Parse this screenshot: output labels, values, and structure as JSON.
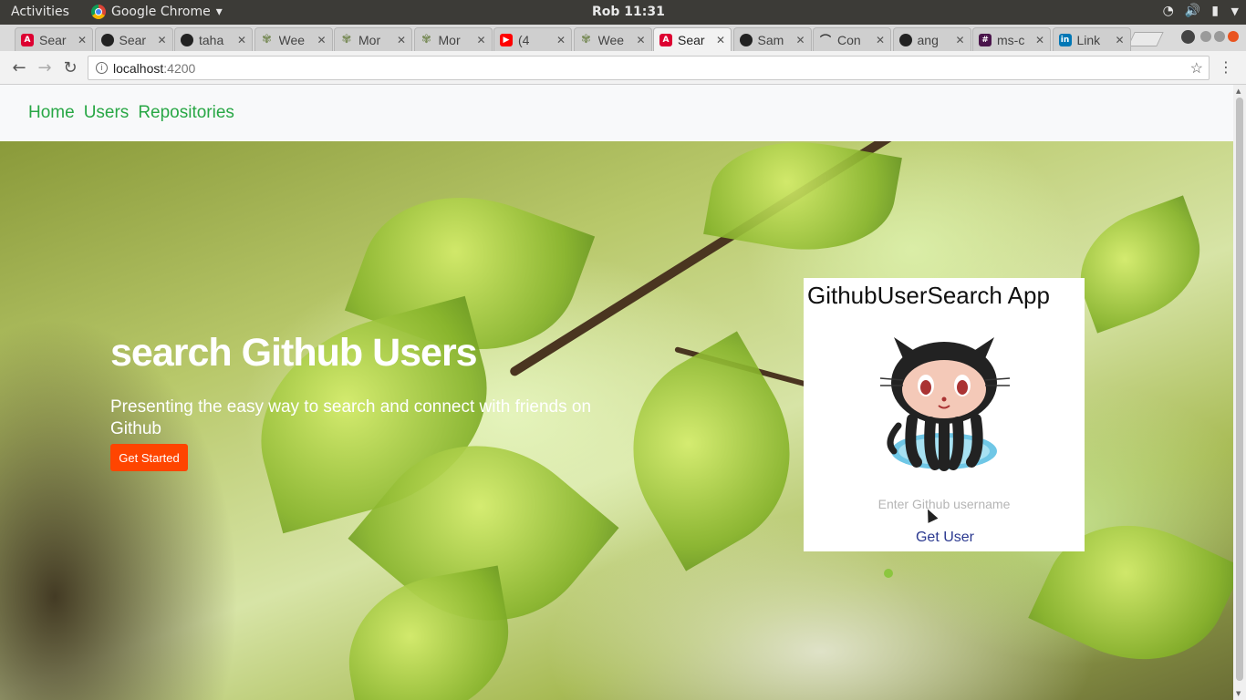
{
  "os_bar": {
    "activities": "Activities",
    "app_name": "Google Chrome",
    "clock": "Rob 11:31"
  },
  "tabs": [
    {
      "favicon": "angular-icon",
      "title": "Sear",
      "active": false
    },
    {
      "favicon": "github-icon",
      "title": "Sear",
      "active": false
    },
    {
      "favicon": "github-icon",
      "title": "taha",
      "active": false
    },
    {
      "favicon": "tree-icon",
      "title": "Wee",
      "active": false
    },
    {
      "favicon": "tree-icon",
      "title": "Mor",
      "active": false
    },
    {
      "favicon": "tree-icon",
      "title": "Mor",
      "active": false
    },
    {
      "favicon": "youtube-icon",
      "title": "(4",
      "active": false
    },
    {
      "favicon": "tree-icon",
      "title": "Wee",
      "active": false
    },
    {
      "favicon": "angular-icon",
      "title": "Sear",
      "active": true
    },
    {
      "favicon": "github-icon",
      "title": "Sam",
      "active": false
    },
    {
      "favicon": "conn-icon",
      "title": "Con",
      "active": false
    },
    {
      "favicon": "github-icon",
      "title": "ang",
      "active": false
    },
    {
      "favicon": "slack-icon",
      "title": "ms-c",
      "active": false
    },
    {
      "favicon": "linkedin-icon",
      "title": "Link",
      "active": false
    }
  ],
  "address": {
    "host": "localhost",
    "port": ":4200"
  },
  "site_nav": {
    "home": "Home",
    "users": "Users",
    "repositories": "Repositories"
  },
  "hero": {
    "title": "search Github Users",
    "subtitle": "Presenting the easy way to search and connect with friends on Github",
    "cta": "Get Started"
  },
  "card": {
    "title": "GithubUserSearch App",
    "input_placeholder": "Enter Github username",
    "input_value": "",
    "button": "Get User"
  },
  "colors": {
    "nav_link": "#28a745",
    "cta": "#ff4500",
    "get_user": "#2b3990"
  }
}
